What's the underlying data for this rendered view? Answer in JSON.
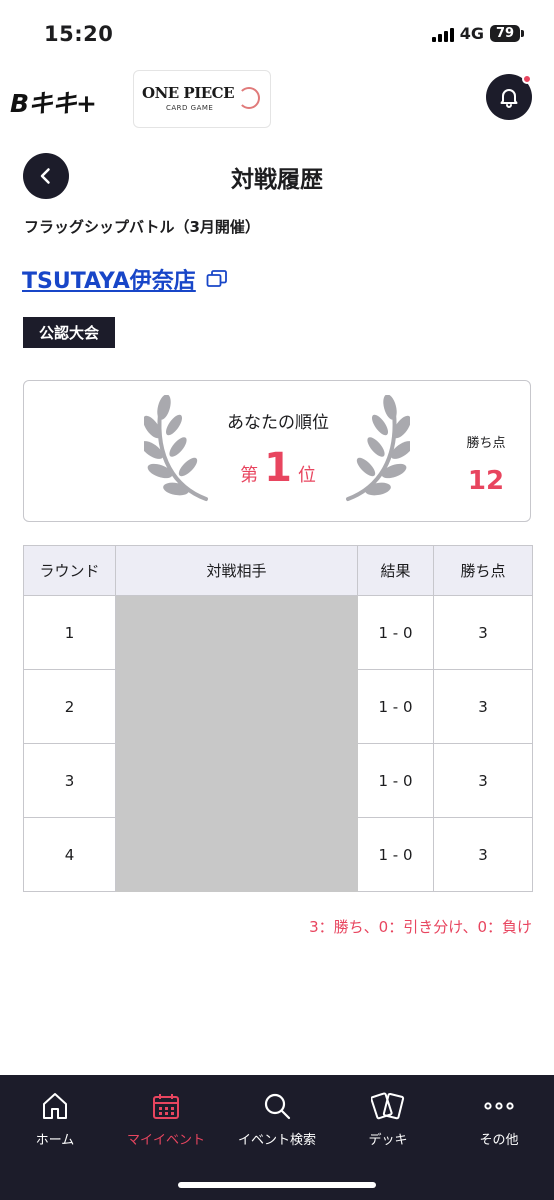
{
  "status_bar": {
    "time": "15:20",
    "network": "4G",
    "battery": "79"
  },
  "header": {
    "brand": "Bキキ+",
    "game_logo_main": "ONE PIECE",
    "game_logo_sub": "CARD GAME"
  },
  "page": {
    "title": "対戦履歴",
    "event_name": "フラッグシップバトル（3月開催）",
    "store_name": "TSUTAYA伊奈店",
    "badge": "公認大会"
  },
  "rank": {
    "label": "あなたの順位",
    "prefix": "第",
    "value": "1",
    "suffix": "位",
    "points_label": "勝ち点",
    "points_value": "12"
  },
  "table": {
    "headers": {
      "round": "ラウンド",
      "opponent": "対戦相手",
      "result": "結果",
      "points": "勝ち点"
    },
    "rows": [
      {
        "round": "1",
        "opponent": "",
        "result": "1 - 0",
        "points": "3"
      },
      {
        "round": "2",
        "opponent": "",
        "result": "1 - 0",
        "points": "3"
      },
      {
        "round": "3",
        "opponent": "",
        "result": "1 - 0",
        "points": "3"
      },
      {
        "round": "4",
        "opponent": "",
        "result": "1 - 0",
        "points": "3"
      }
    ]
  },
  "legend": "3：勝ち、0：引き分け、0：負け",
  "nav": {
    "items": [
      {
        "label": "ホーム",
        "icon": "home-icon"
      },
      {
        "label": "マイイベント",
        "icon": "calendar-icon",
        "active": true
      },
      {
        "label": "イベント検索",
        "icon": "search-icon"
      },
      {
        "label": "デッキ",
        "icon": "cards-icon"
      },
      {
        "label": "その他",
        "icon": "more-icon"
      }
    ]
  },
  "colors": {
    "accent": "#e8455f",
    "dark": "#1c1c2a",
    "link": "#1846c8",
    "table_header_bg": "#ededf5"
  }
}
